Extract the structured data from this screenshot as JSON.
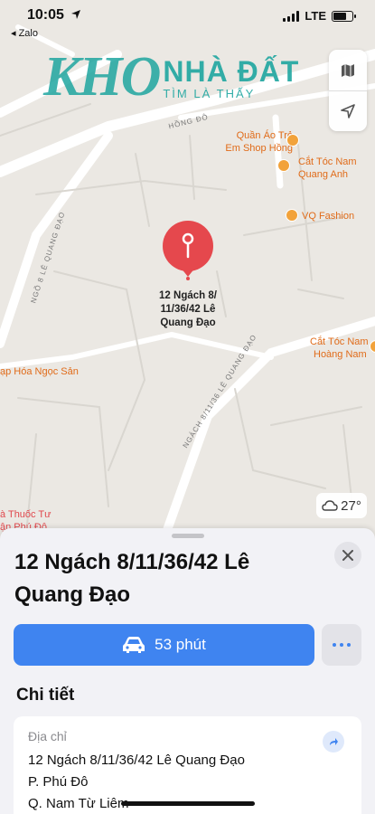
{
  "status": {
    "time": "10:05",
    "back_app": "◂ Zalo",
    "network": "LTE"
  },
  "watermark": {
    "logo_left": "KHO",
    "title": "NHÀ ĐẤT",
    "subtitle": "TÌM LÀ THẤY"
  },
  "map": {
    "road_labels": {
      "hong_do": "HỒNG ĐÔ",
      "ngo_8": "NGÕ 8 LÊ QUANG ĐẠO",
      "ngach_8_11_36": "NGÁCH 8/11/36 LÊ QUANG ĐẠO"
    },
    "pois": {
      "quan_ao_1": "Quần Áo Trẻ",
      "quan_ao_2": "Em Shop Hồng",
      "cat_toc_1a": "Cắt Tóc Nam",
      "cat_toc_1b": "Quang Anh",
      "vq_fashion": "VQ Fashion",
      "cat_toc_2a": "Cắt Tóc Nam",
      "cat_toc_2b": "Hoàng Nam",
      "tap_hoa": "ạp Hóa Ngọc Sản",
      "thuoc_a": "à Thuốc Tư",
      "thuoc_b": "ận Phú Đô"
    },
    "pin_label": "12 Ngách 8/ 11/36/42 Lê Quang Đạo",
    "weather": "27°",
    "icons": {
      "map_mode": "map-icon",
      "locate": "location-arrow-icon",
      "weather": "cloud-icon"
    }
  },
  "place": {
    "title": "12 Ngách 8/11/36/42 Lê Quang Đạo",
    "directions_label": "53 phút",
    "section_title": "Chi tiết",
    "address_label": "Địa chỉ",
    "address_lines": [
      "12 Ngách 8/11/36/42 Lê Quang Đạo",
      "P. Phú Đô",
      "Q. Nam Từ Liêm"
    ]
  },
  "colors": {
    "accent": "#3f84f0",
    "pin": "#e5484d",
    "poi": "#e06b19",
    "watermark": "#1fa6a0"
  }
}
